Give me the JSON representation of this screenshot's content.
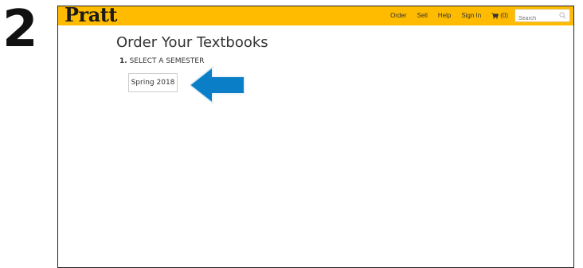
{
  "step_number": "2",
  "header": {
    "logo": "Pratt",
    "nav": [
      "Order",
      "Sell",
      "Help",
      "Sign In"
    ],
    "cart_label": "(0)",
    "search_placeholder": "Search"
  },
  "main": {
    "title": "Order Your Textbooks",
    "step_prefix": "1.",
    "step_label": "SELECT A SEMESTER",
    "semester_option": "Spring 2018"
  },
  "colors": {
    "header_bg": "#ffbb00",
    "arrow": "#0a7fc8"
  },
  "icons": {
    "cart": "cart-icon",
    "search": "search-icon",
    "arrow": "left-arrow-icon"
  }
}
